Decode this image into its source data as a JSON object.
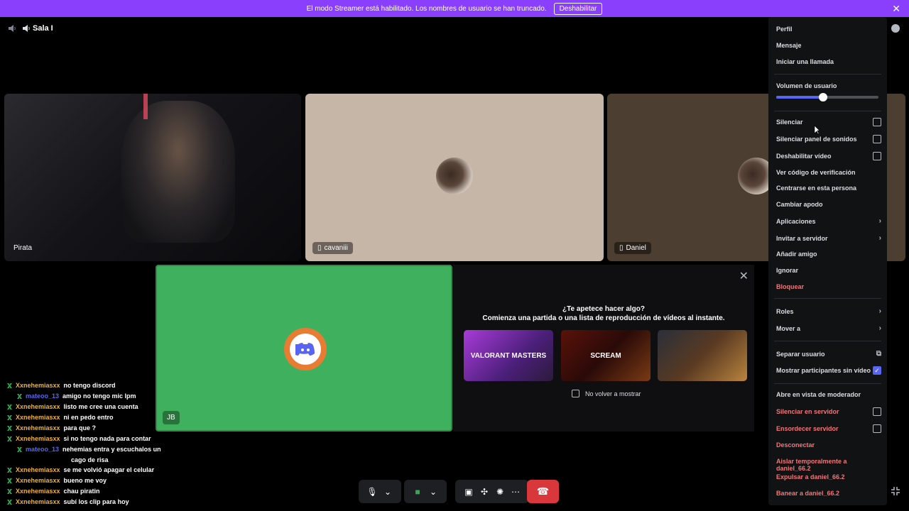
{
  "banner": {
    "text": "El modo Streamer está habilitado. Los nombres de usuario se han truncado.",
    "button": "Deshabilitar"
  },
  "header": {
    "channel": "Sala I"
  },
  "tiles": [
    {
      "name": "Pirata"
    },
    {
      "name": "cavaniii"
    },
    {
      "name": "Daniel"
    }
  ],
  "green_tile": {
    "initials": "JB"
  },
  "activity": {
    "question": "¿Te apetece hacer algo?",
    "subtitle": "Comienza una partida o una lista de reproducción de vídeos al instante.",
    "cards": [
      "VALORANT MASTERS",
      "SCREAM",
      ""
    ],
    "checkbox": "No volver a mostrar"
  },
  "chat": {
    "messages": [
      {
        "user": "Xxnehemiasxx",
        "text": "no tengo discord",
        "type": "x"
      },
      {
        "user": "mateoo_13",
        "text": "amigo no tengo mic lpm",
        "type": "m"
      },
      {
        "user": "Xxnehemiasxx",
        "text": "listo me cree una cuenta",
        "type": "x"
      },
      {
        "user": "Xxnehemiasxx",
        "text": "ni en pedo entro",
        "type": "x"
      },
      {
        "user": "Xxnehemiasxx",
        "text": "para que ?",
        "type": "x"
      },
      {
        "user": "Xxnehemiasxx",
        "text": "si no tengo nada para contar",
        "type": "x"
      },
      {
        "user": "mateoo_13",
        "text": "nehemias entra y escuchalos un",
        "type": "m",
        "cont": "cago de risa"
      },
      {
        "user": "Xxnehemiasxx",
        "text": "se me volvió apagar el celular",
        "type": "x"
      },
      {
        "user": "Xxnehemiasxx",
        "text": "bueno me voy",
        "type": "x"
      },
      {
        "user": "Xxnehemiasxx",
        "text": "chau piratin",
        "type": "x"
      },
      {
        "user": "Xxnehemiasxx",
        "text": "subí los clip para hoy",
        "type": "x"
      }
    ]
  },
  "menu": {
    "profile": "Perfil",
    "message": "Mensaje",
    "call": "Iniciar una llamada",
    "volume_label": "Volumen de usuario",
    "volume_level": 0.46,
    "mute": "Silenciar",
    "mute_soundboard": "Silenciar panel de sonidos",
    "disable_video": "Deshabilitar vídeo",
    "verify_code": "Ver código de verificación",
    "focus": "Centrarse en esta persona",
    "nickname": "Cambiar apodo",
    "apps": "Aplicaciones",
    "invite": "Invitar a servidor",
    "add_friend": "Añadir amigo",
    "ignore": "Ignorar",
    "block": "Bloquear",
    "roles": "Roles",
    "move": "Mover a",
    "popout": "Separar usuario",
    "show_non_video": "Mostrar participantes sin vídeo",
    "moderator_view": "Abre en vista de moderador",
    "server_mute": "Silenciar en servidor",
    "server_deafen": "Ensordecer servidor",
    "disconnect": "Desconectar",
    "timeout": "Aislar temporalmente a daniel_66.2",
    "kick": "Expulsar a daniel_66.2",
    "ban": "Banear a daniel_66.2"
  },
  "colors": {
    "brand": "#5865f2",
    "banner": "#8a3ffc",
    "danger": "#da373c",
    "green_tile": "#3fb05d"
  }
}
